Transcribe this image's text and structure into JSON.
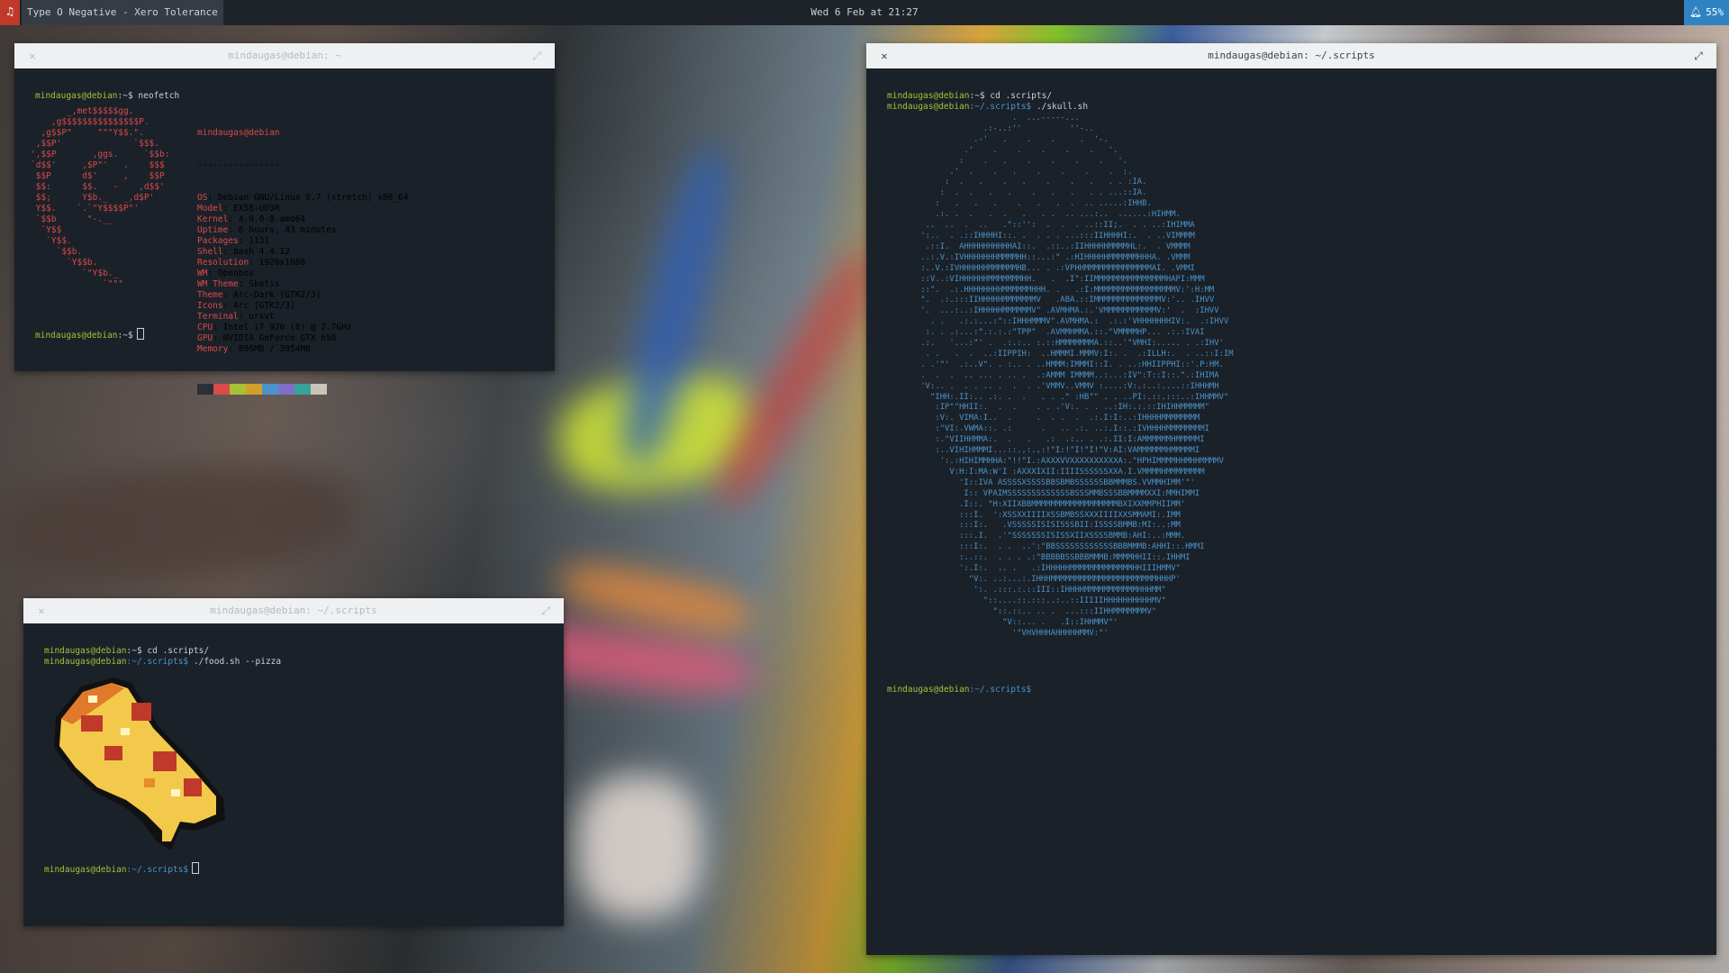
{
  "topbar": {
    "now_playing": "Type O Negative - Xero Tolerance",
    "music_icon": "music-note-icon",
    "clock": "Wed 6 Feb at 21:27",
    "battery": "55%",
    "battery_icon": "bell-icon"
  },
  "prompt": {
    "user": "mindaugas@debian",
    "home_sep": ":~$",
    "scripts_path": ":~/.scripts$"
  },
  "win_neofetch": {
    "title": "mindaugas@debian: ~",
    "command": "neofetch",
    "header": "mindaugas@debian",
    "underline": "----------------",
    "info": [
      {
        "k": "OS",
        "v": "Debian GNU/Linux 9.7 (stretch) x86_64"
      },
      {
        "k": "Model",
        "v": "EX58-UD3R"
      },
      {
        "k": "Kernel",
        "v": "4.9.0-8-amd64"
      },
      {
        "k": "Uptime",
        "v": "6 hours, 43 minutes"
      },
      {
        "k": "Packages",
        "v": "1131"
      },
      {
        "k": "Shell",
        "v": "bash 4.4.12"
      },
      {
        "k": "Resolution",
        "v": "1920x1080"
      },
      {
        "k": "WM",
        "v": "Openbox"
      },
      {
        "k": "WM Theme",
        "v": "Sketis"
      },
      {
        "k": "Theme",
        "v": "Arc-Dark [GTK2/3]"
      },
      {
        "k": "Icons",
        "v": "Arc [GTK2/3]"
      },
      {
        "k": "Terminal",
        "v": "urxvt"
      },
      {
        "k": "CPU",
        "v": "Intel i7 920 (8) @ 2.7GHz"
      },
      {
        "k": "GPU",
        "v": "NVIDIA GeForce GTX 650"
      },
      {
        "k": "Memory",
        "v": "896MB / 3954MB"
      }
    ],
    "swatch_colors": [
      "#2b3036",
      "#d94a4a",
      "#a7c137",
      "#d1a028",
      "#4a94c9",
      "#7e6fc9",
      "#36a398",
      "#c9c3b8"
    ]
  },
  "win_pizza": {
    "title": "mindaugas@debian: ~/.scripts",
    "cmd1": "cd .scripts/",
    "cmd2": "./food.sh --pizza"
  },
  "win_skull": {
    "title": "mindaugas@debian: ~/.scripts",
    "cmd1": "cd .scripts/",
    "cmd2": "./skull.sh"
  }
}
